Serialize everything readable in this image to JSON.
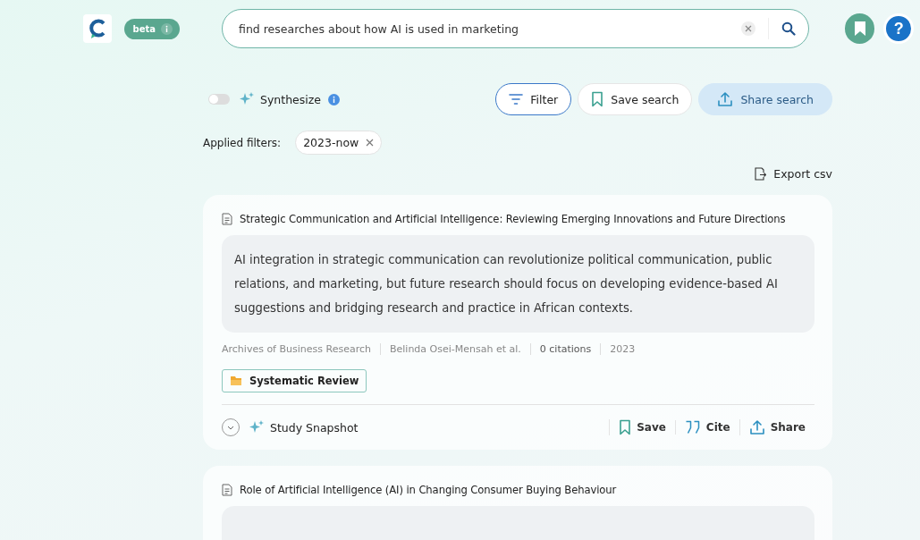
{
  "header": {
    "badge": "beta",
    "search": {
      "value": "find researches about how AI is used in marketing"
    },
    "help": "?"
  },
  "toolbar": {
    "synthesize": {
      "label": "Synthesize",
      "on": false
    },
    "buttons": [
      {
        "kind": "filter",
        "label": "Filter"
      },
      {
        "kind": "save",
        "label": "Save search"
      },
      {
        "kind": "share",
        "label": "Share search"
      }
    ]
  },
  "applied_filters": {
    "label": "Applied filters:",
    "chips": [
      "2023-now"
    ]
  },
  "export": "Export csv",
  "results": [
    {
      "title": "Strategic Communication and Artificial Intelligence: Reviewing Emerging Innovations and Future Directions",
      "summary": "AI integration in strategic communication can revolutionize political communication, public relations, and marketing, but future research should focus on developing evidence-based AI suggestions and bridging research and practice in African contexts.",
      "meta": [
        "Archives of Business Research",
        "Belinda Osei-Mensah et al.",
        "0 citations",
        "2023"
      ],
      "tag": "Systematic Review",
      "snapshot": "Study Snapshot",
      "actions": [
        {
          "kind": "save",
          "label": "Save"
        },
        {
          "kind": "cite",
          "label": "Cite"
        },
        {
          "kind": "share",
          "label": "Share"
        }
      ]
    },
    {
      "title": "Role of Artificial Intelligence (AI) in Changing Consumer Buying Behaviour"
    }
  ]
}
